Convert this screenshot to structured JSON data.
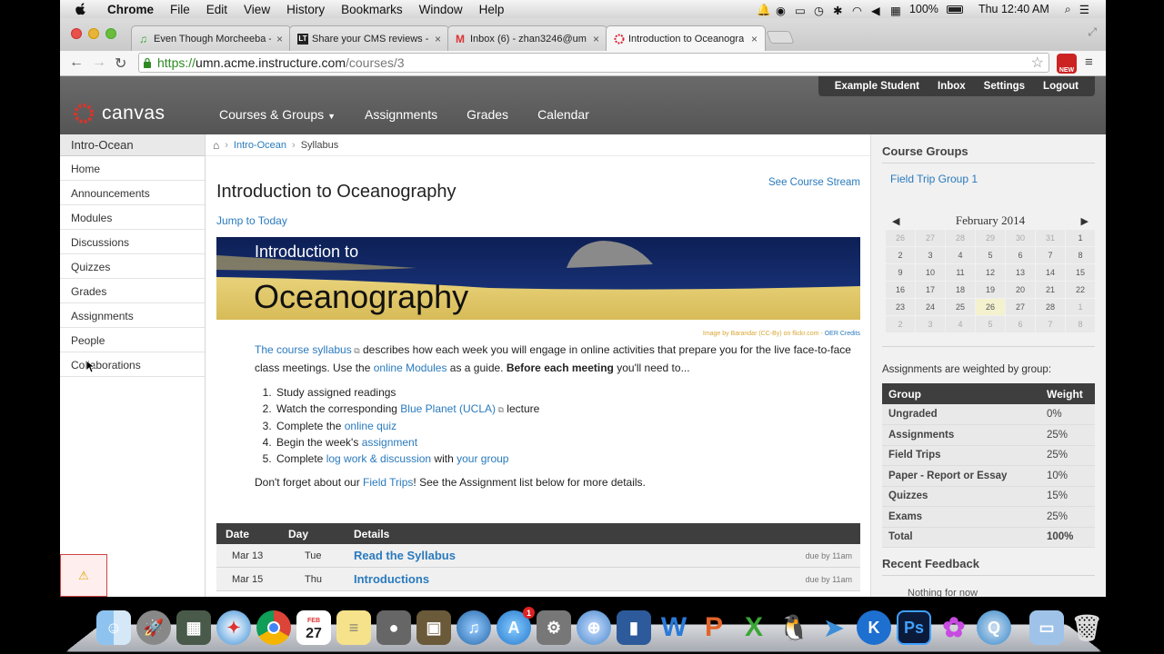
{
  "menubar": {
    "app": "Chrome",
    "items": [
      "File",
      "Edit",
      "View",
      "History",
      "Bookmarks",
      "Window",
      "Help"
    ],
    "battery": "100%",
    "clock": "Thu 12:40 AM"
  },
  "browser": {
    "tabs": [
      {
        "title": "Even Though Morcheeba -",
        "icon": "music-note-icon"
      },
      {
        "title": "Share your CMS reviews -",
        "icon": "lt-icon"
      },
      {
        "title": "Inbox (6) - zhan3246@um",
        "icon": "gmail-icon"
      },
      {
        "title": "Introduction to Oceanogra",
        "icon": "canvas-icon"
      }
    ],
    "url": {
      "scheme": "https://",
      "host": "umn.acme.instructure.com",
      "path": "/courses/3"
    },
    "extension_badge": "NEW"
  },
  "canvas_header": {
    "logo": "canvas",
    "user_nav": [
      "Example Student",
      "Inbox",
      "Settings",
      "Logout"
    ],
    "main_nav": [
      {
        "label": "Courses & Groups",
        "dropdown": true
      },
      {
        "label": "Assignments"
      },
      {
        "label": "Grades"
      },
      {
        "label": "Calendar"
      }
    ]
  },
  "course_nav": {
    "course": "Intro-Ocean",
    "items": [
      "Home",
      "Announcements",
      "Modules",
      "Discussions",
      "Quizzes",
      "Grades",
      "Assignments",
      "People",
      "Collaborations"
    ]
  },
  "breadcrumb": {
    "course": "Intro-Ocean",
    "page": "Syllabus"
  },
  "page": {
    "title": "Introduction to Oceanography",
    "see_stream": "See Course Stream",
    "jump_today": "Jump to Today",
    "banner_line1": "Introduction to",
    "banner_line2": "Oceanography",
    "credit": "Image by Barandar (CC-By) on flickr.com - ",
    "credit_link": "OER Credits",
    "intro": {
      "link1": "The course syllabus",
      "t1": " describes how each week you will engage in online activities that prepare you for the live face-to-face class meetings. Use the ",
      "link2": "online Modules",
      "t2": " as a guide. ",
      "bold": "Before each meeting",
      "t3": " you'll need to..."
    },
    "steps": [
      {
        "pre": "Study assigned readings",
        "link": "",
        "post": ""
      },
      {
        "pre": "Watch the corresponding ",
        "link": "Blue Planet (UCLA)",
        "post": " lecture"
      },
      {
        "pre": "Complete the ",
        "link": "online quiz",
        "post": ""
      },
      {
        "pre": "Begin the week's ",
        "link": "assignment",
        "post": ""
      },
      {
        "pre": "Complete ",
        "link": "log work & discussion",
        "post": " with ",
        "link2": "your group"
      }
    ],
    "footer": {
      "pre": "Don't forget about our ",
      "link": "Field Trips",
      "post": "! See the Assignment list below for more details."
    },
    "schedule": {
      "headers": [
        "Date",
        "Day",
        "Details"
      ],
      "rows": [
        {
          "date": "Mar 13",
          "day": "Tue",
          "detail": "Read the Syllabus",
          "due": "due by 11am"
        },
        {
          "date": "Mar 15",
          "day": "Thu",
          "detail": "Introductions",
          "due": "due by 11am"
        }
      ]
    }
  },
  "sidebar": {
    "groups_title": "Course Groups",
    "group": "Field Trip Group 1",
    "calendar": {
      "month": "February 2014",
      "weeks": [
        [
          "26",
          "27",
          "28",
          "29",
          "30",
          "31",
          "1"
        ],
        [
          "2",
          "3",
          "4",
          "5",
          "6",
          "7",
          "8"
        ],
        [
          "9",
          "10",
          "11",
          "12",
          "13",
          "14",
          "15"
        ],
        [
          "16",
          "17",
          "18",
          "19",
          "20",
          "21",
          "22"
        ],
        [
          "23",
          "24",
          "25",
          "26",
          "27",
          "28",
          "1"
        ],
        [
          "2",
          "3",
          "4",
          "5",
          "6",
          "7",
          "8"
        ]
      ]
    },
    "weights_label": "Assignments are weighted by group:",
    "weights_headers": [
      "Group",
      "Weight"
    ],
    "weights": [
      {
        "group": "Ungraded",
        "weight": "0%"
      },
      {
        "group": "Assignments",
        "weight": "25%"
      },
      {
        "group": "Field Trips",
        "weight": "25%"
      },
      {
        "group": "Paper - Report or Essay",
        "weight": "10%"
      },
      {
        "group": "Quizzes",
        "weight": "15%"
      },
      {
        "group": "Exams",
        "weight": "25%"
      },
      {
        "group": "Total",
        "weight": "100%"
      }
    ],
    "feedback_title": "Recent Feedback",
    "feedback_empty": "Nothing for now"
  },
  "dock": {
    "apps": [
      "finder-icon",
      "launchpad-icon",
      "system-prefs-icon",
      "safari-icon",
      "chrome-icon",
      "calendar-icon",
      "stickies-icon",
      "facetime-icon",
      "iphoto-icon",
      "itunes-icon",
      "appstore-icon",
      "preferences-icon",
      "network-icon",
      "dictionary-icon",
      "word-icon",
      "powerpoint-icon",
      "excel-icon",
      "qq-icon",
      "bird-icon",
      "k-icon",
      "photoshop-icon",
      "flower-icon",
      "search-icon",
      "folder-icon",
      "trash-icon"
    ],
    "calendar_day": "27",
    "calendar_month": "FEB",
    "appstore_badge": "1"
  }
}
